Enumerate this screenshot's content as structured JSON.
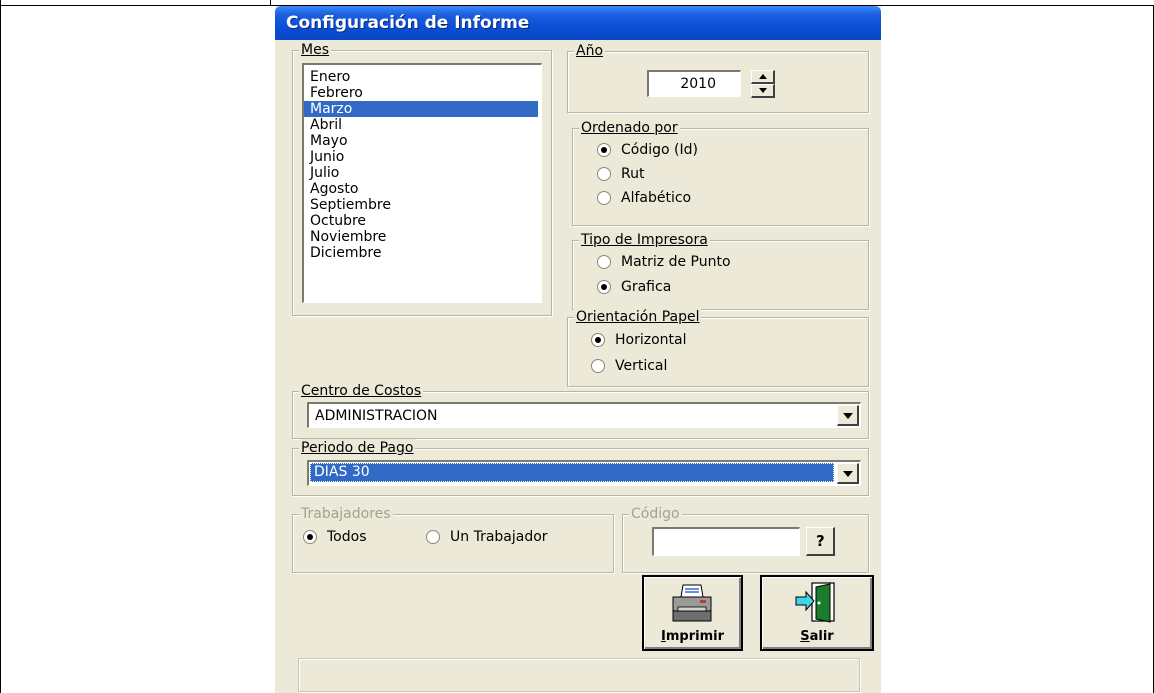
{
  "dialog": {
    "title": "Configuración de Informe"
  },
  "mes": {
    "legend": "Mes",
    "items": [
      "Enero",
      "Febrero",
      "Marzo",
      "Abril",
      "Mayo",
      "Junio",
      "Julio",
      "Agosto",
      "Septiembre",
      "Octubre",
      "Noviembre",
      "Diciembre"
    ],
    "selected": "Marzo"
  },
  "anio": {
    "legend": "Año",
    "value": "2010"
  },
  "ordenado": {
    "legend": "Ordenado por",
    "options": [
      "Código (Id)",
      "Rut",
      "Alfabético"
    ],
    "selected": "Código (Id)"
  },
  "impresora": {
    "legend": "Tipo de Impresora",
    "options": [
      "Matriz de Punto",
      "Grafica"
    ],
    "selected": "Grafica"
  },
  "orientacion": {
    "legend": "Orientación Papel",
    "options": [
      "Horizontal",
      "Vertical"
    ],
    "selected": "Horizontal"
  },
  "centro": {
    "legend": "Centro de Costos",
    "value": "ADMINISTRACION"
  },
  "periodo": {
    "legend": "Periodo de Pago",
    "value": "DIAS 30"
  },
  "trabajadores": {
    "legend": "Trabajadores",
    "options": [
      "Todos",
      "Un Trabajador"
    ],
    "selected": "Todos"
  },
  "codigo": {
    "legend": "Código",
    "value": "",
    "help_label": "?"
  },
  "buttons": {
    "imprimir": {
      "label_first": "I",
      "label_rest": "mprimir",
      "icon": "printer-icon"
    },
    "salir": {
      "label_first": "S",
      "label_rest": "alir",
      "icon": "exit-door-icon"
    }
  },
  "colors": {
    "title_bar": "#0a4fd6",
    "selection": "#316ac5",
    "dialog_bg": "#ece9d8"
  }
}
